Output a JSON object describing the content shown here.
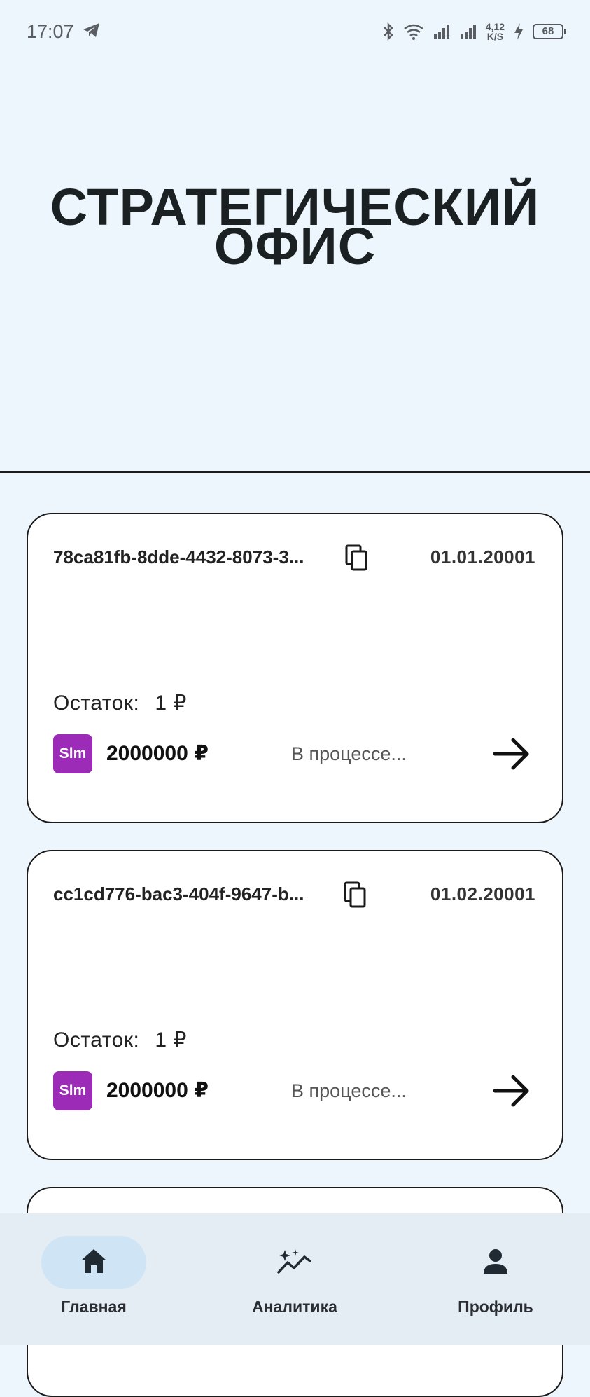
{
  "status_bar": {
    "time": "17:07",
    "speed_value": "4,12",
    "speed_unit": "K/S",
    "battery": "68"
  },
  "header": {
    "title_line1": "СТРАТЕГИЧЕСКИЙ",
    "title_line2": "ОФИС"
  },
  "cards": [
    {
      "id": "78ca81fb-8dde-4432-8073-3...",
      "date": "01.01.20001",
      "balance_label": "Остаток:",
      "balance_value": "1 ₽",
      "badge": "Slm",
      "amount": "2000000 ₽",
      "status": "В процессе..."
    },
    {
      "id": "cc1cd776-bac3-404f-9647-b...",
      "date": "01.02.20001",
      "balance_label": "Остаток:",
      "balance_value": "1 ₽",
      "badge": "Slm",
      "amount": "2000000 ₽",
      "status": "В процессе..."
    }
  ],
  "bottom_nav": {
    "items": [
      {
        "label": "Главная",
        "icon": "home-icon",
        "active": true
      },
      {
        "label": "Аналитика",
        "icon": "analytics-icon",
        "active": false
      },
      {
        "label": "Профиль",
        "icon": "profile-icon",
        "active": false
      }
    ]
  },
  "colors": {
    "background": "#eef6fd",
    "badge": "#9c2bb8",
    "nav_background": "#e4ecf4",
    "nav_active_pill": "#cfe4f4"
  }
}
